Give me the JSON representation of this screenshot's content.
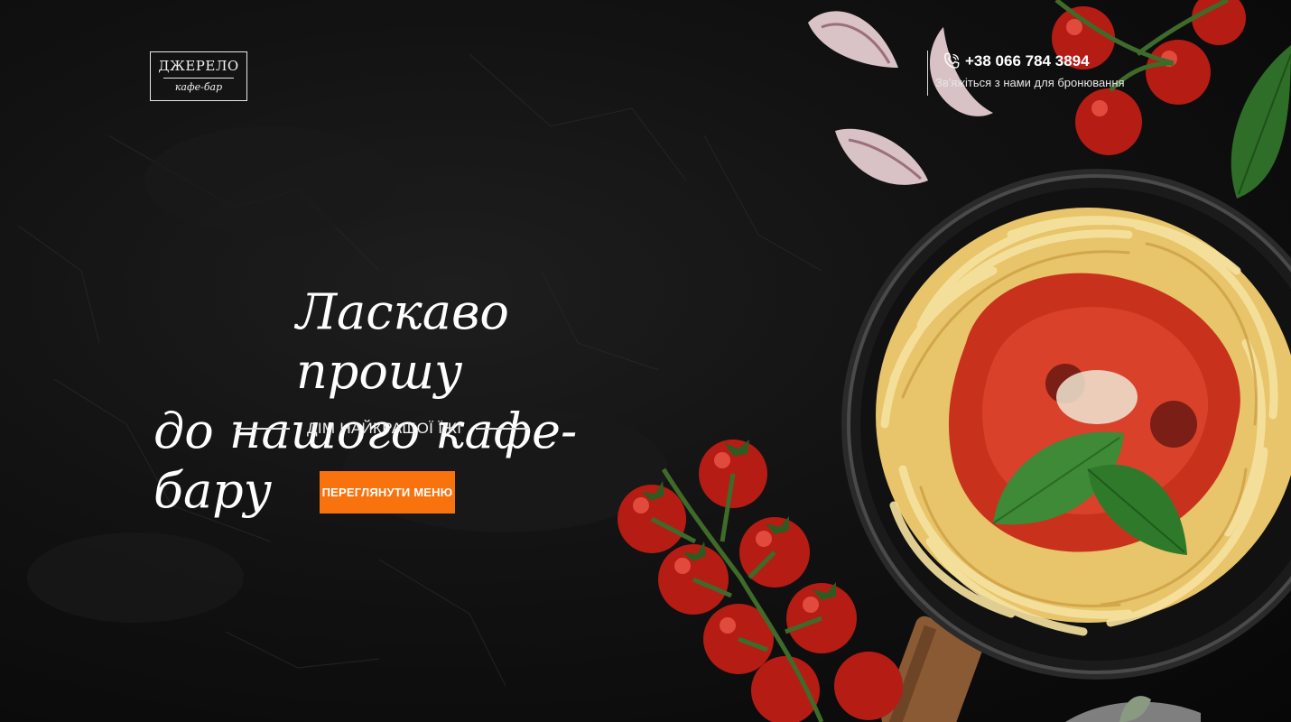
{
  "logo": {
    "name": "ДЖЕРЕЛО",
    "subtitle": "кафе-бар"
  },
  "contact": {
    "icon": "phone-icon",
    "phone": "+38 066 784 3894",
    "note": "Зв'яжіться з нами для бронювання"
  },
  "hero": {
    "title_line1": "Ласкаво прошу",
    "title_line2": "до нашого кафе-бару",
    "subtitle": "ДІМ НАЙКРАЩОЇ ЇЖІ",
    "cta_label": "ПЕРЕГЛЯНУТИ МЕНЮ"
  },
  "colors": {
    "accent": "#f8720d",
    "background": "#121212",
    "text": "#ffffff"
  }
}
